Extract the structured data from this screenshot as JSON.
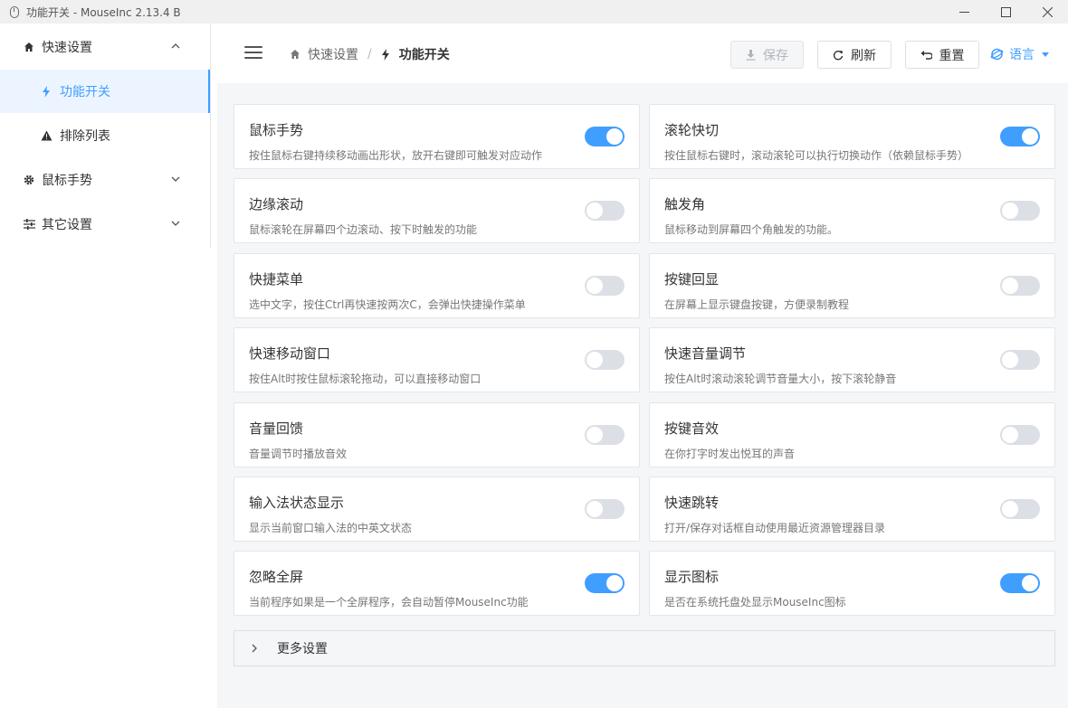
{
  "window": {
    "title": "功能开关 - MouseInc 2.13.4 B",
    "controls": [
      "minimize-icon",
      "maximize-icon",
      "close-icon"
    ]
  },
  "sidebar": {
    "items": [
      {
        "label": "快速设置",
        "icon": "home-icon",
        "expanded": true
      },
      {
        "label": "功能开关",
        "icon": "lightning-icon",
        "active": true
      },
      {
        "label": "排除列表",
        "icon": "warning-icon"
      },
      {
        "label": "鼠标手势",
        "icon": "gear-icon",
        "expanded": false
      },
      {
        "label": "其它设置",
        "icon": "sliders-icon",
        "expanded": false
      }
    ]
  },
  "header": {
    "breadcrumb": [
      "快速设置",
      "功能开关"
    ],
    "breadcrumb_sep": "/",
    "buttons": {
      "save": "保存",
      "refresh": "刷新",
      "reset": "重置"
    },
    "language": "语言"
  },
  "features": [
    {
      "title": "鼠标手势",
      "desc": "按住鼠标右键持续移动画出形状，放开右键即可触发对应动作",
      "enabled": true
    },
    {
      "title": "滚轮快切",
      "desc": "按住鼠标右键时，滚动滚轮可以执行切换动作（依赖鼠标手势）",
      "enabled": true
    },
    {
      "title": "边缘滚动",
      "desc": "鼠标滚轮在屏幕四个边滚动、按下时触发的功能",
      "enabled": false
    },
    {
      "title": "触发角",
      "desc": "鼠标移动到屏幕四个角触发的功能。",
      "enabled": false
    },
    {
      "title": "快捷菜单",
      "desc": "选中文字，按住Ctrl再快速按两次C，会弹出快捷操作菜单",
      "enabled": false
    },
    {
      "title": "按键回显",
      "desc": "在屏幕上显示键盘按键，方便录制教程",
      "enabled": false
    },
    {
      "title": "快速移动窗口",
      "desc": "按住Alt时按住鼠标滚轮拖动，可以直接移动窗口",
      "enabled": false
    },
    {
      "title": "快速音量调节",
      "desc": "按住Alt时滚动滚轮调节音量大小，按下滚轮静音",
      "enabled": false
    },
    {
      "title": "音量回馈",
      "desc": "音量调节时播放音效",
      "enabled": false
    },
    {
      "title": "按键音效",
      "desc": "在你打字时发出悦耳的声音",
      "enabled": false
    },
    {
      "title": "输入法状态显示",
      "desc": "显示当前窗口输入法的中英文状态",
      "enabled": false
    },
    {
      "title": "快速跳转",
      "desc": "打开/保存对话框自动使用最近资源管理器目录",
      "enabled": false
    },
    {
      "title": "忽略全屏",
      "desc": "当前程序如果是一个全屏程序，会自动暂停MouseInc功能",
      "enabled": true
    },
    {
      "title": "显示图标",
      "desc": "是否在系统托盘处显示MouseInc图标",
      "enabled": true
    }
  ],
  "more_settings": "更多设置",
  "colors": {
    "accent": "#409eff",
    "toggle_off": "#dcdfe6",
    "background": "#f5f6f8"
  }
}
